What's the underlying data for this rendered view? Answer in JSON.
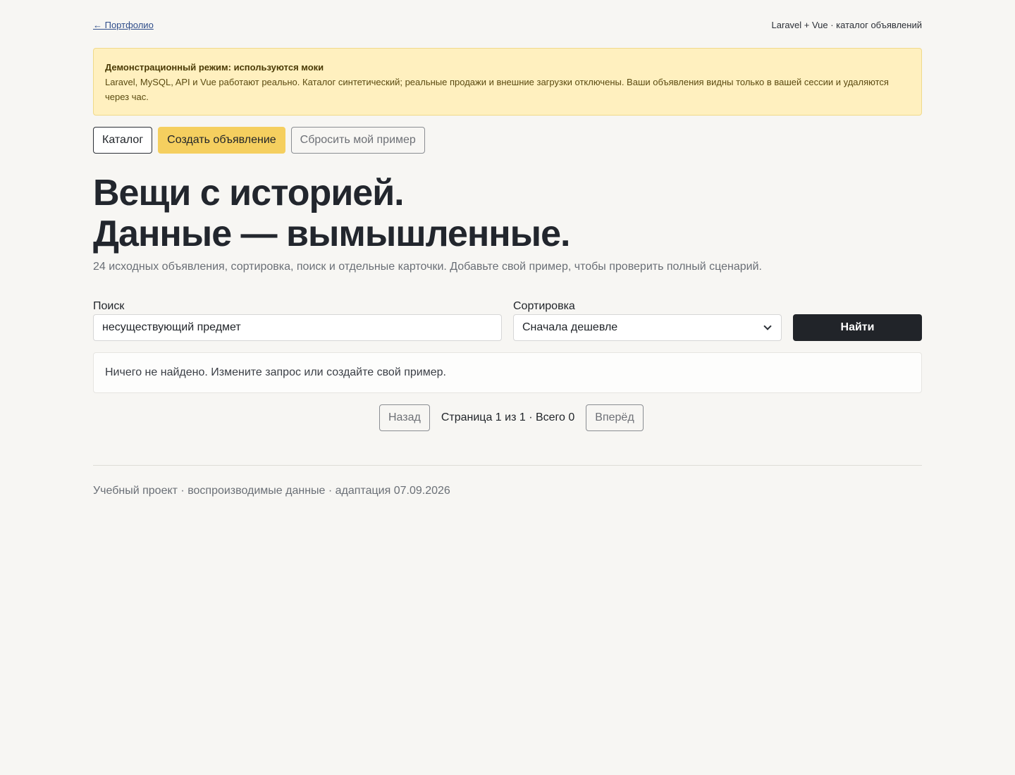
{
  "topbar": {
    "back_link": "← Портфолио",
    "tagline": "Laravel + Vue · каталог объявлений"
  },
  "notice": {
    "title": "Демонстрационный режим: используются моки",
    "text": "Laravel, MySQL, API и Vue работают реально. Каталог синтетический; реальные продажи и внешние загрузки отключены. Ваши объявления видны только в вашей сессии и удаляются через час."
  },
  "actions": {
    "catalog": "Каталог",
    "create": "Создать объявление",
    "reset": "Сбросить мой пример"
  },
  "hero": {
    "title_line1": "Вещи с историей.",
    "title_line2": "Данные — вымышленные.",
    "subtitle": "24 исходных объявления, сортировка, поиск и отдельные карточки. Добавьте свой пример, чтобы проверить полный сценарий."
  },
  "filters": {
    "search_label": "Поиск",
    "search_value": "несуществующий предмет",
    "sort_label": "Сортировка",
    "sort_value": "Сначала дешевле",
    "find_button": "Найти"
  },
  "results": {
    "empty_message": "Ничего не найдено. Измените запрос или создайте свой пример."
  },
  "pager": {
    "prev": "Назад",
    "info": "Страница 1 из 1 · Всего 0",
    "next": "Вперёд"
  },
  "footer": {
    "text": "Учебный проект · воспроизводимые данные · адаптация 07.09.2026"
  },
  "colors": {
    "background": "#f7f6f3",
    "notice_bg": "#fff0bf",
    "accent_yellow": "#f5cf5f",
    "dark_button": "#212429"
  }
}
